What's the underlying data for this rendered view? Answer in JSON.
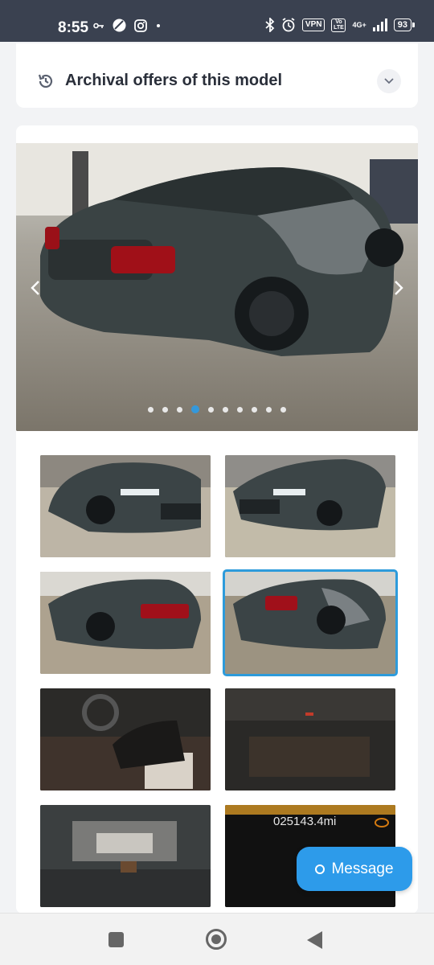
{
  "status_bar": {
    "time": "8:55",
    "left_icons": [
      "key-icon",
      "no-disturb-icon",
      "instagram-icon",
      "dot-icon"
    ],
    "right_icons": [
      "bluetooth-icon",
      "alarm-icon",
      "vpn-badge",
      "volte-badge",
      "signal-icon",
      "battery-icon"
    ],
    "vpn_label": "VPN",
    "volte_label": "Vo LTE",
    "network_label": "4G+",
    "battery_level": "93"
  },
  "archival": {
    "title": "Archival offers of this model",
    "icon": "history-icon",
    "expand_icon": "chevron-down-icon"
  },
  "gallery": {
    "total_photos": 10,
    "active_index": 3,
    "thumbnails": [
      {
        "label": "front-left-damage"
      },
      {
        "label": "front-right"
      },
      {
        "label": "rear-left"
      },
      {
        "label": "rear-right-damage",
        "selected": true
      },
      {
        "label": "interior-front"
      },
      {
        "label": "interior-rear"
      },
      {
        "label": "engine-bay"
      },
      {
        "label": "odometer"
      }
    ],
    "odometer_text": "025143.4mi"
  },
  "message_button": {
    "label": "Message",
    "color": "#2d9bea"
  },
  "colors": {
    "status_bar": "#3a4150",
    "accent": "#3498db"
  }
}
